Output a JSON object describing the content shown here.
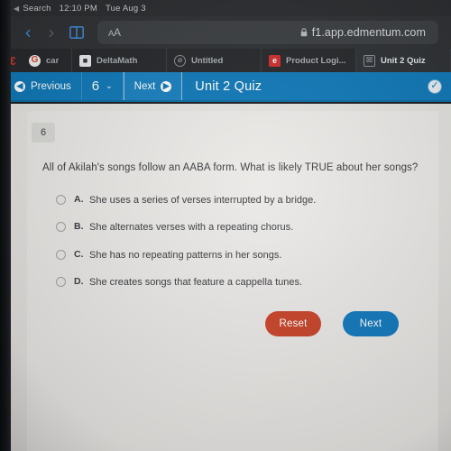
{
  "status_bar": {
    "back_label": "Search",
    "back_arrow_glyph": "◀",
    "time": "12:10 PM",
    "date": "Tue Aug 3"
  },
  "browser": {
    "back_glyph": "‹",
    "forward_glyph": "›",
    "text_size_big": "A",
    "text_size_small": "A",
    "url": "f1.app.edmentum.com",
    "tabs": [
      {
        "label": "",
        "favicon": "c-icon",
        "favicon_glyph": "€",
        "active": false,
        "kind": "pinned"
      },
      {
        "label": "car",
        "favicon": "google-icon",
        "favicon_glyph": "G",
        "active": false,
        "kind": "pinned2"
      },
      {
        "label": "DeltaMath",
        "favicon": "deltamath-icon",
        "favicon_glyph": "■",
        "active": false,
        "kind": "wide"
      },
      {
        "label": "Untitled",
        "favicon": "untitled-icon",
        "favicon_glyph": "⊘",
        "active": false,
        "kind": "wide"
      },
      {
        "label": "Product Logi...",
        "favicon": "edmentum-icon",
        "favicon_glyph": "e",
        "active": false,
        "kind": "wide"
      },
      {
        "label": "Unit 2 Quiz",
        "favicon": "quiz-icon",
        "favicon_glyph": "☒",
        "active": true,
        "kind": "wide"
      }
    ]
  },
  "app_toolbar": {
    "previous_label": "Previous",
    "previous_icon_glyph": "◀",
    "question_number": "6",
    "dropdown_glyph": "⌄",
    "next_label": "Next",
    "next_icon_glyph": "▶",
    "title": "Unit 2 Quiz",
    "submit_check_glyph": "✓"
  },
  "question": {
    "number": "6",
    "text": "All of Akilah's songs follow an AABA form. What is likely TRUE about her songs?",
    "options": [
      {
        "letter": "A.",
        "text": "She uses a series of verses interrupted by a bridge.",
        "selected": false
      },
      {
        "letter": "B.",
        "text": "She alternates verses with a repeating chorus.",
        "selected": false
      },
      {
        "letter": "C.",
        "text": "She has no repeating patterns in her songs.",
        "selected": false
      },
      {
        "letter": "D.",
        "text": "She creates songs that feature a cappella tunes.",
        "selected": false
      }
    ]
  },
  "actions": {
    "reset_label": "Reset",
    "next_label": "Next"
  },
  "colors": {
    "toolbar_blue": "#1179b8",
    "reset_red": "#c8442a",
    "next_blue": "#1479bd",
    "page_bg": "#e4e3e0"
  }
}
